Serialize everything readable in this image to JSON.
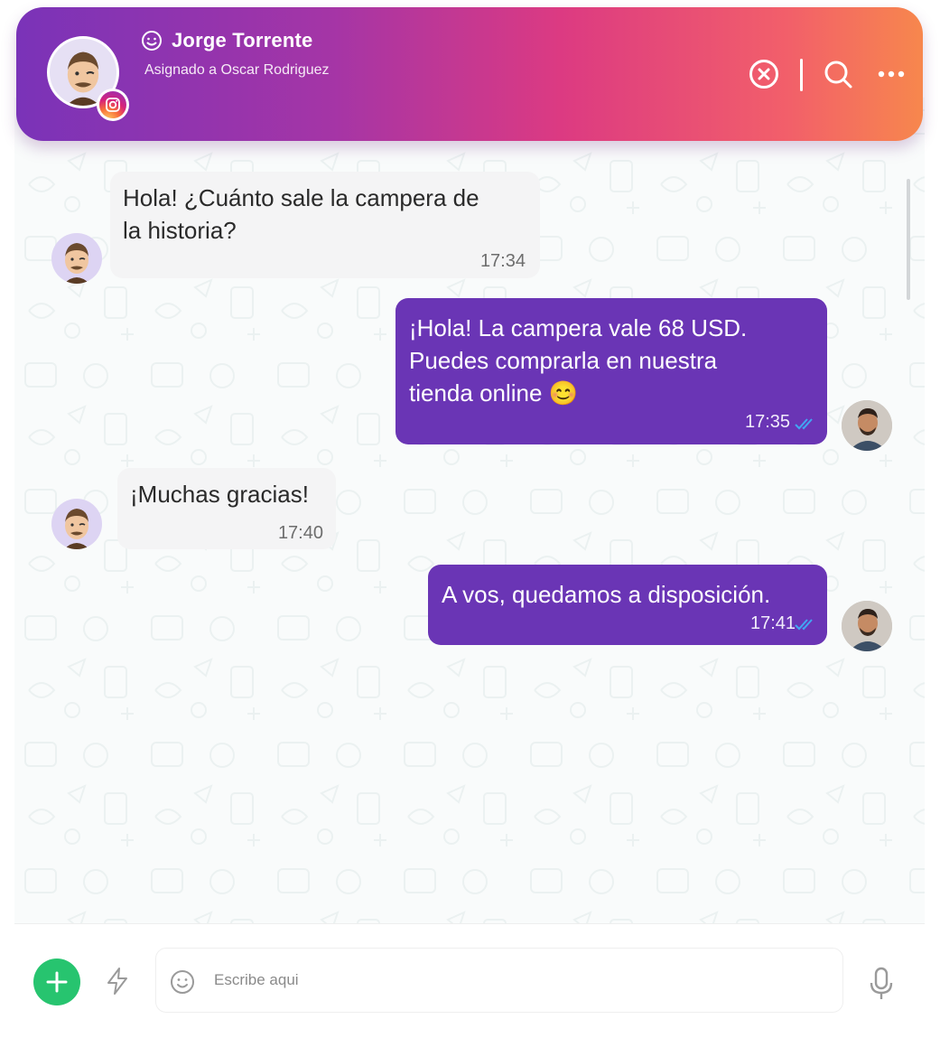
{
  "header": {
    "contact_name": "Jorge Torrente",
    "assigned_text": "Asignado a Oscar Rodriguez",
    "channel_icon": "instagram-icon",
    "actions": [
      "close-conversation-icon",
      "search-icon",
      "more-options-icon"
    ]
  },
  "messages": [
    {
      "direction": "in",
      "lines": [
        "Hola! ¿Cuánto sale la campera de",
        "la historia?"
      ],
      "time": "17:34"
    },
    {
      "direction": "out",
      "lines": [
        "¡Hola! La campera vale 68 USD.",
        "Puedes comprarla en nuestra",
        "tienda online 😊"
      ],
      "time": "17:35",
      "status": "read"
    },
    {
      "direction": "in",
      "lines": [
        "¡Muchas gracias!"
      ],
      "time": "17:40"
    },
    {
      "direction": "out",
      "lines": [
        "A vos, quedamos a disposición."
      ],
      "time": "17:41",
      "status": "read"
    }
  ],
  "composer": {
    "placeholder": "Escribe aqui",
    "icons": [
      "add-icon",
      "lightning-icon",
      "emoji-icon",
      "microphone-icon"
    ]
  },
  "colors": {
    "header_gradient": [
      "#7a33b8",
      "#dc3a82",
      "#f7874d"
    ],
    "outgoing_bubble": "#6a35b5",
    "incoming_bubble": "#f4f4f5",
    "read_tick": "#41a6f3",
    "add_button": "#27c46f"
  }
}
